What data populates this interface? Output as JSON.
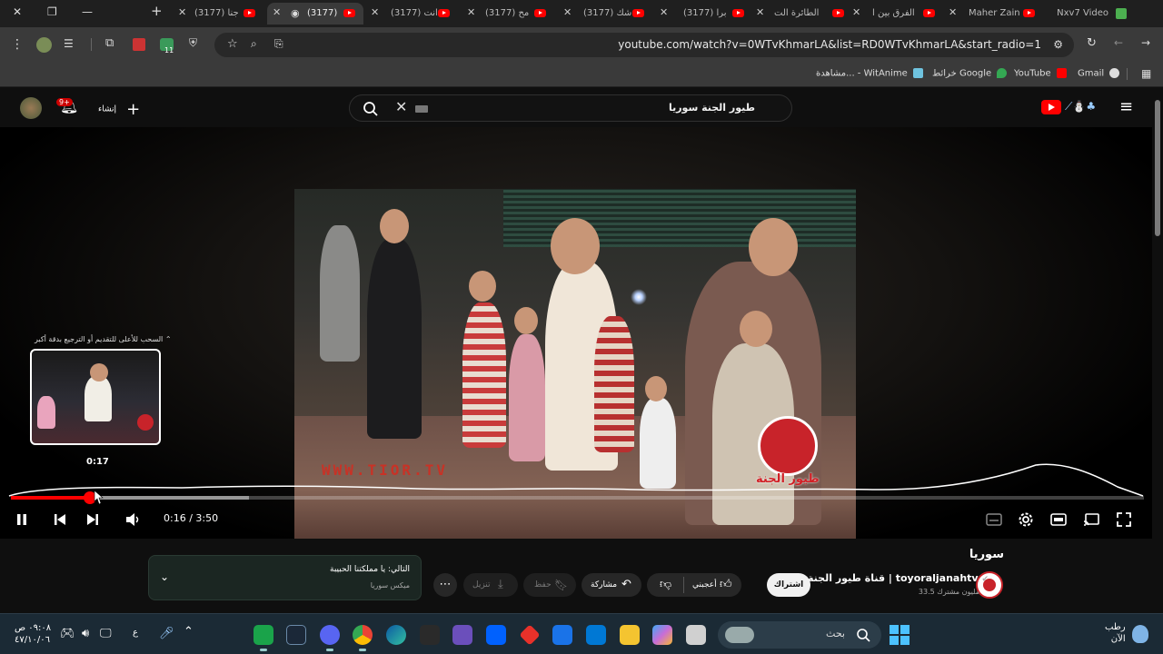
{
  "tabs": [
    {
      "label": "Nxv7 Video",
      "active": false
    },
    {
      "label": "Maher Zain",
      "active": false
    },
    {
      "label": "الفرق بين ا",
      "active": false
    },
    {
      "label": "الطائرة الت",
      "active": false
    },
    {
      "label": "(3177) برا",
      "active": false
    },
    {
      "label": "(3177) شك",
      "active": false
    },
    {
      "label": "(3177) مح",
      "active": false
    },
    {
      "label": "(3177) انت",
      "active": false
    },
    {
      "label": "(3177)",
      "active": true
    },
    {
      "label": "(3177) جنا",
      "active": false
    }
  ],
  "address": {
    "url": "youtube.com/watch?v=0WTvKhmarLA&list=RD0WTvKhmarLA&start_radio=1",
    "extension_badge": "11"
  },
  "bookmarks": [
    {
      "label": "Gmail",
      "color": "#ffffff"
    },
    {
      "label": "YouTube",
      "color": "#ff0000"
    },
    {
      "label": "خرائط Google",
      "color": "#34a853"
    },
    {
      "label": "مشاهدة... - WitAnime",
      "color": "#6fc3df"
    }
  ],
  "yt_header": {
    "search_query": "طيور الجنة سوريا",
    "create_label": "إنشاء",
    "notifications_badge": "9+"
  },
  "player": {
    "video_watermark": "WWW.TIOR.TV",
    "logo_text": "طيور الجنة",
    "preview_hint": "السحب للأعلى للتقديم أو الترجيع بدقة أكبر",
    "preview_time": "0:17",
    "time_current": "0:16",
    "time_total": "3:50",
    "time_display": "0:16 / 3:50",
    "progress_fraction": 0.07,
    "buffered_fraction": 0.21
  },
  "video_info": {
    "title": "سوريا",
    "channel_name": "قناة طيور الجنة | toyoraljanahtv",
    "subscribers": "33.5 مليون مشترك",
    "subscribe_label": "اشتراك",
    "like_label": "أعجبني",
    "share_label": "مشاركة",
    "save_label": "حفظ",
    "download_label": "تنزيل"
  },
  "up_next": {
    "title": "التالي: يا مملكتنا الحبيبة",
    "subtitle": "ميكس سوريا"
  },
  "taskbar": {
    "search_placeholder": "بحث",
    "weather": "رطب",
    "weather_sub": "الآن",
    "time": "٠٩:٠٨ ص",
    "date": "٤٧/١٠/٠٦",
    "lang": "ع"
  }
}
